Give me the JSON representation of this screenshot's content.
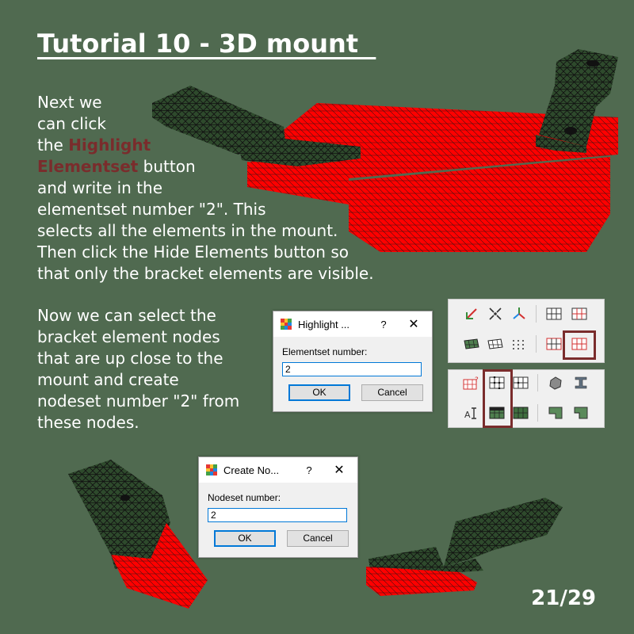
{
  "title": "Tutorial 10 - 3D mount  ",
  "paragraph1": {
    "lines": [
      "Next we",
      "can click"
    ],
    "the_word": "the ",
    "highlight_1": "Highlight",
    "highlight_2": "Elementset",
    "after_highlight": " button",
    "rest_lines": [
      "and write in the",
      "elementset number \"2\". This",
      "selects all the elements in the mount.",
      "Then click the Hide Elements button so",
      "that only the bracket elements are visible."
    ]
  },
  "paragraph2": {
    "lines": [
      "Now we can select the",
      "bracket element nodes",
      "that are up close to the",
      "mount and create",
      "nodeset number \"2\" from",
      "these nodes."
    ]
  },
  "dialog_highlight": {
    "title": "Highlight ...",
    "help": "?",
    "close": "✕",
    "label": "Elementset number:",
    "value": "2",
    "ok": "OK",
    "cancel": "Cancel"
  },
  "dialog_nodeset": {
    "title": "Create No...",
    "help": "?",
    "close": "✕",
    "label": "Nodeset number:",
    "value": "2",
    "ok": "OK",
    "cancel": "Cancel"
  },
  "page_number": "21/29",
  "colors": {
    "background": "#506a50",
    "highlight_text": "#7a2c2c",
    "mesh_red": "#ff0000",
    "mesh_green": "#2e4a2c",
    "focus_border": "#7a2c2c"
  },
  "icons": {
    "toolbar_top": [
      "rotate-axes-icon",
      "shrink-nodes-icon",
      "axis-triad-icon",
      "element-grid-icon",
      "element-grid-red-icon",
      "shaded-plate-icon",
      "mesh-plate-icon",
      "node-dots-icon",
      "hide-elements-icon",
      "highlight-elementset-icon"
    ],
    "toolbar_bottom": [
      "node-select-question-icon",
      "create-nodeset-icon",
      "nodeset-grid-icon",
      "solid-shape-icon",
      "i-beam-icon",
      "scale-node-icon",
      "filled-grid-icon",
      "dark-grid-icon",
      "l-shape-icon",
      "l-shape-cut-icon"
    ]
  }
}
